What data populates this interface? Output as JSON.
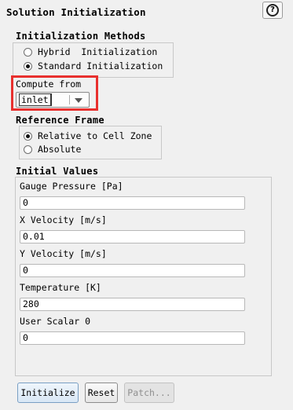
{
  "panel": {
    "title": "Solution Initialization",
    "help_icon": "?"
  },
  "init_methods": {
    "title": "Initialization Methods",
    "options": [
      {
        "label": "Hybrid  Initialization",
        "selected": false
      },
      {
        "label": "Standard Initialization",
        "selected": true
      }
    ]
  },
  "compute_from": {
    "label": "Compute from",
    "value": "inlet"
  },
  "reference_frame": {
    "title": "Reference Frame",
    "options": [
      {
        "label": "Relative to Cell Zone",
        "selected": true
      },
      {
        "label": "Absolute",
        "selected": false
      }
    ]
  },
  "initial_values": {
    "title": "Initial Values",
    "fields": [
      {
        "label": "Gauge Pressure [Pa]",
        "value": "0"
      },
      {
        "label": "X Velocity [m/s]",
        "value": "0.01"
      },
      {
        "label": "Y Velocity [m/s]",
        "value": "0"
      },
      {
        "label": "Temperature [K]",
        "value": "280"
      },
      {
        "label": "User Scalar 0",
        "value": "0"
      }
    ]
  },
  "buttons": {
    "initialize": "Initialize",
    "reset": "Reset",
    "patch": "Patch..."
  },
  "colors": {
    "highlight": "#e8302e",
    "background": "#f0f0f0"
  }
}
